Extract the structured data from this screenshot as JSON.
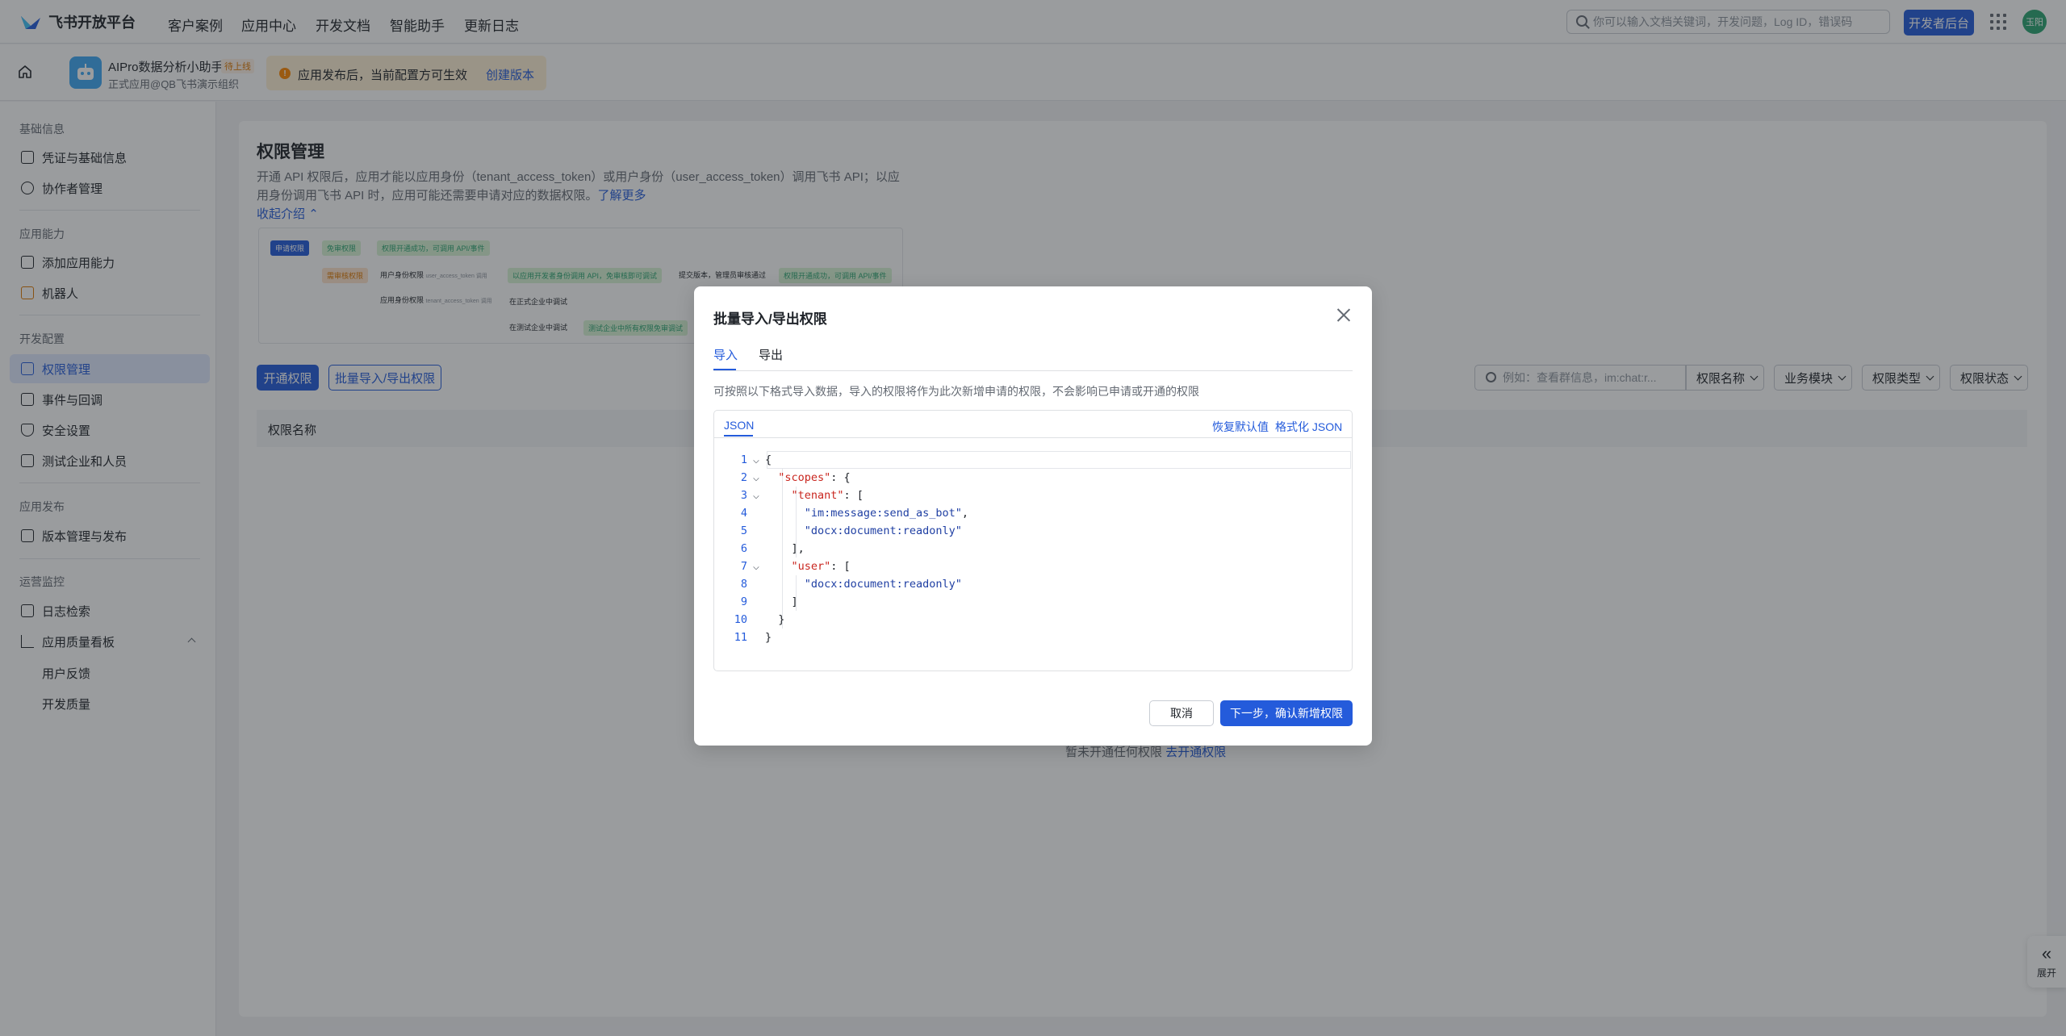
{
  "header": {
    "logo_text": "飞书开放平台",
    "nav": [
      "客户案例",
      "应用中心",
      "开发文档",
      "智能助手",
      "更新日志"
    ],
    "search_placeholder": "你可以输入文档关键词，开发问题，Log ID，错误码",
    "dev_console_label": "开发者后台",
    "avatar_text": "玉阳"
  },
  "app": {
    "name": "AIPro数据分析小助手",
    "badge": "待上线",
    "subtitle": "正式应用@QB飞书演示组织",
    "notice": "应用发布后，当前配置方可生效",
    "notice_action": "创建版本"
  },
  "sidebar": {
    "groups": [
      {
        "title": "基础信息",
        "items": [
          "凭证与基础信息",
          "协作者管理"
        ]
      },
      {
        "title": "应用能力",
        "items": [
          "添加应用能力",
          "机器人"
        ]
      },
      {
        "title": "开发配置",
        "items": [
          "权限管理",
          "事件与回调",
          "安全设置",
          "测试企业和人员"
        ]
      },
      {
        "title": "应用发布",
        "items": [
          "版本管理与发布"
        ]
      },
      {
        "title": "运营监控",
        "items": [
          "日志检索",
          "应用质量看板"
        ]
      }
    ],
    "sub_items": [
      "用户反馈",
      "开发质量"
    ],
    "active": "权限管理"
  },
  "page": {
    "title": "权限管理",
    "desc": "开通 API 权限后，应用才能以应用身份（tenant_access_token）或用户身份（user_access_token）调用飞书 API；以应用身份调用飞书 API 时，应用可能还需要申请对应的数据权限。",
    "learn_more": "了解更多",
    "collapse": "收起介绍",
    "flow": {
      "apply": "申请权限",
      "free": "免审权限",
      "free_result": "权限开通成功，可调用 API/事件",
      "review": "需审核权限",
      "user_token": "用户身份权限",
      "user_token_sub": "user_access_token 调用",
      "user_result": "以应用开发者身份调用 API，免审核即可调试",
      "submit": "提交版本，管理员审核通过",
      "final_result": "权限开通成功，可调用 API/事件",
      "tenant_token": "应用身份权限",
      "tenant_token_sub": "tenant_access_token 调用",
      "formal_debug": "在正式企业中调试",
      "test_debug": "在测试企业中调试",
      "test_result": "测试企业中所有权限免审调试"
    },
    "open_button": "开通权限",
    "batch_button": "批量导入/导出权限",
    "filter_placeholder": "例如：查看群信息，im:chat:r...",
    "filters": [
      "权限名称",
      "业务模块",
      "权限类型",
      "权限状态"
    ],
    "table_header": "权限名称",
    "empty_text": "暂未开通任何权限",
    "empty_link": "去开通权限"
  },
  "modal": {
    "title": "批量导入/导出权限",
    "tabs": [
      "导入",
      "导出"
    ],
    "hint": "可按照以下格式导入数据，导入的权限将作为此次新增申请的权限，不会影响已申请或开通的权限",
    "editor_tab": "JSON",
    "restore_default": "恢复默认值",
    "format_json": "格式化 JSON",
    "code_lines": [
      {
        "n": "1",
        "fold": "⌵",
        "text": "{"
      },
      {
        "n": "2",
        "fold": "⌵",
        "text": "  \"scopes\": {"
      },
      {
        "n": "3",
        "fold": "⌵",
        "text": "    \"tenant\": ["
      },
      {
        "n": "4",
        "fold": "",
        "text": "      \"im:message:send_as_bot\","
      },
      {
        "n": "5",
        "fold": "",
        "text": "      \"docx:document:readonly\""
      },
      {
        "n": "6",
        "fold": "",
        "text": "    ],"
      },
      {
        "n": "7",
        "fold": "⌵",
        "text": "    \"user\": ["
      },
      {
        "n": "8",
        "fold": "",
        "text": "      \"docx:document:readonly\""
      },
      {
        "n": "9",
        "fold": "",
        "text": "    ]"
      },
      {
        "n": "10",
        "fold": "",
        "text": "  }"
      },
      {
        "n": "11",
        "fold": "",
        "text": "}"
      }
    ],
    "cancel": "取消",
    "next": "下一步，确认新增权限"
  },
  "expand": {
    "icon": "«",
    "label": "展开"
  },
  "colors": {
    "primary": "#245bdb",
    "warning": "#ff8800",
    "success": "#2ba471"
  }
}
